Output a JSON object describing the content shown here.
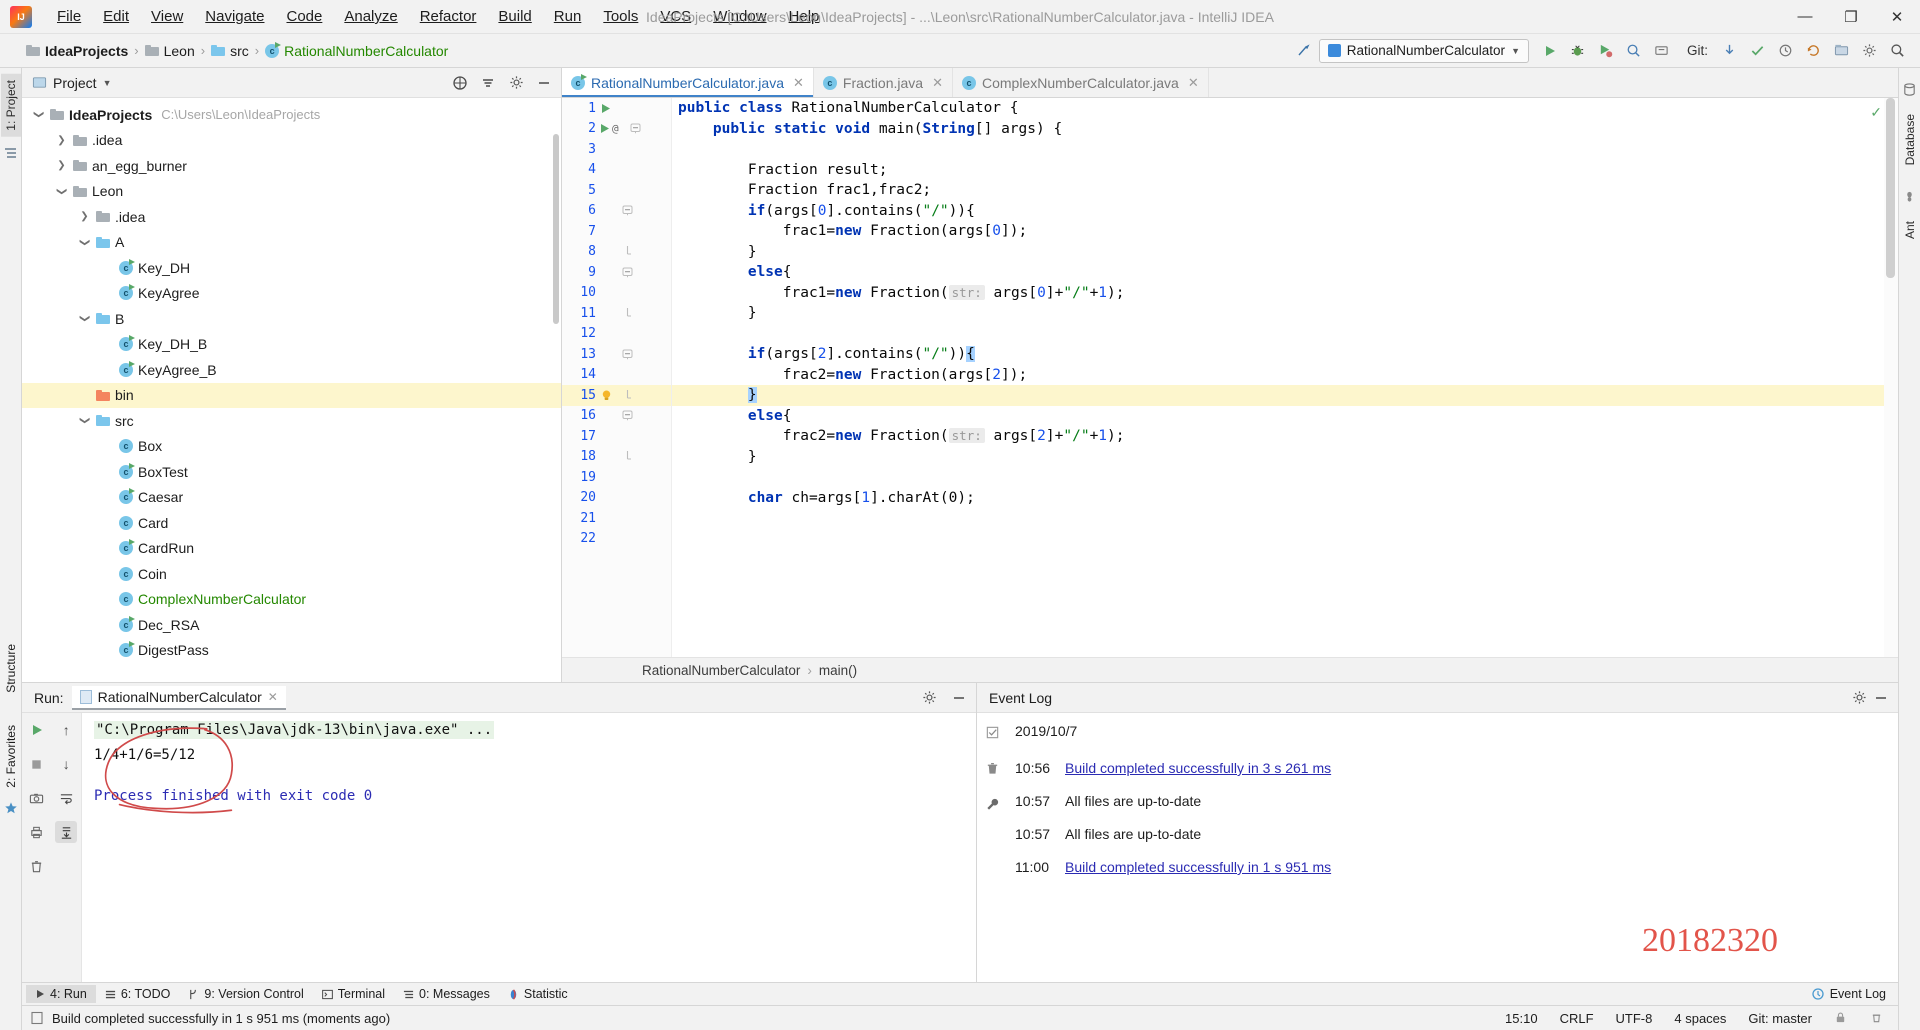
{
  "window": {
    "title": "IdeaProjects [C:\\Users\\Leon\\IdeaProjects] - ...\\Leon\\src\\RationalNumberCalculator.java - IntelliJ IDEA",
    "minimize": "—",
    "maximize": "❐",
    "close": "✕"
  },
  "menu": [
    {
      "label": "File"
    },
    {
      "label": "Edit"
    },
    {
      "label": "View"
    },
    {
      "label": "Navigate"
    },
    {
      "label": "Code"
    },
    {
      "label": "Analyze"
    },
    {
      "label": "Refactor"
    },
    {
      "label": "Build"
    },
    {
      "label": "Run"
    },
    {
      "label": "Tools"
    },
    {
      "label": "VCS"
    },
    {
      "label": "Window"
    },
    {
      "label": "Help"
    }
  ],
  "navbar": {
    "crumbs": [
      {
        "label": "IdeaProjects",
        "icon": "folder-gray",
        "style": "bold"
      },
      {
        "label": "Leon",
        "icon": "folder-gray",
        "style": "normal"
      },
      {
        "label": "src",
        "icon": "folder-blue",
        "style": "normal"
      },
      {
        "label": "RationalNumberCalculator",
        "icon": "class-run",
        "style": "green"
      }
    ],
    "run_config": "RationalNumberCalculator",
    "git_label": "Git:",
    "separator": "›"
  },
  "sidebar_left_tabs": [
    "1: Project",
    "Structure",
    "2: Favorites"
  ],
  "sidebar_right_tabs": [
    "Database",
    "Ant"
  ],
  "project_panel": {
    "title": "Project",
    "tree": [
      {
        "label": "IdeaProjects",
        "sub": "C:\\Users\\Leon\\IdeaProjects",
        "indent": 0,
        "arrow": "down",
        "icon": "folder-gray",
        "bold": true
      },
      {
        "label": ".idea",
        "sub": "",
        "indent": 1,
        "arrow": "right",
        "icon": "folder-gray",
        "bold": false
      },
      {
        "label": "an_egg_burner",
        "sub": "",
        "indent": 1,
        "arrow": "right",
        "icon": "folder-gray",
        "bold": false
      },
      {
        "label": "Leon",
        "sub": "",
        "indent": 1,
        "arrow": "down",
        "icon": "folder-gray",
        "bold": false
      },
      {
        "label": ".idea",
        "sub": "",
        "indent": 2,
        "arrow": "right",
        "icon": "folder-gray",
        "bold": false
      },
      {
        "label": "A",
        "sub": "",
        "indent": 2,
        "arrow": "down",
        "icon": "folder-blue",
        "bold": false
      },
      {
        "label": "Key_DH",
        "sub": "",
        "indent": 3,
        "arrow": "",
        "icon": "class-run",
        "bold": false
      },
      {
        "label": "KeyAgree",
        "sub": "",
        "indent": 3,
        "arrow": "",
        "icon": "class-run",
        "bold": false
      },
      {
        "label": "B",
        "sub": "",
        "indent": 2,
        "arrow": "down",
        "icon": "folder-blue",
        "bold": false
      },
      {
        "label": "Key_DH_B",
        "sub": "",
        "indent": 3,
        "arrow": "",
        "icon": "class-run",
        "bold": false
      },
      {
        "label": "KeyAgree_B",
        "sub": "",
        "indent": 3,
        "arrow": "",
        "icon": "class-run",
        "bold": false
      },
      {
        "label": "bin",
        "sub": "",
        "indent": 2,
        "arrow": "",
        "icon": "folder-orange",
        "bold": false,
        "highlight": true
      },
      {
        "label": "src",
        "sub": "",
        "indent": 2,
        "arrow": "down",
        "icon": "folder-blue",
        "bold": false
      },
      {
        "label": "Box",
        "sub": "",
        "indent": 3,
        "arrow": "",
        "icon": "class",
        "bold": false
      },
      {
        "label": "BoxTest",
        "sub": "",
        "indent": 3,
        "arrow": "",
        "icon": "class-run",
        "bold": false
      },
      {
        "label": "Caesar",
        "sub": "",
        "indent": 3,
        "arrow": "",
        "icon": "class-run",
        "bold": false
      },
      {
        "label": "Card",
        "sub": "",
        "indent": 3,
        "arrow": "",
        "icon": "class",
        "bold": false
      },
      {
        "label": "CardRun",
        "sub": "",
        "indent": 3,
        "arrow": "",
        "icon": "class-run",
        "bold": false
      },
      {
        "label": "Coin",
        "sub": "",
        "indent": 3,
        "arrow": "",
        "icon": "class",
        "bold": false
      },
      {
        "label": "ComplexNumberCalculator",
        "sub": "",
        "indent": 3,
        "arrow": "",
        "icon": "class",
        "bold": false,
        "green": true
      },
      {
        "label": "Dec_RSA",
        "sub": "",
        "indent": 3,
        "arrow": "",
        "icon": "class-run",
        "bold": false
      },
      {
        "label": "DigestPass",
        "sub": "",
        "indent": 3,
        "arrow": "",
        "icon": "class-run",
        "bold": false
      }
    ]
  },
  "editor": {
    "tabs": [
      {
        "label": "RationalNumberCalculator.java",
        "active": true,
        "close": "✕"
      },
      {
        "label": "Fraction.java",
        "active": false,
        "close": "✕"
      },
      {
        "label": "ComplexNumberCalculator.java",
        "active": false,
        "close": "✕"
      }
    ],
    "lines": [
      {
        "n": 1,
        "mark": "run",
        "fold": "",
        "hl": false
      },
      {
        "n": 2,
        "mark": "run@",
        "fold": "minus",
        "hl": false
      },
      {
        "n": 3,
        "mark": "",
        "fold": "",
        "hl": false
      },
      {
        "n": 4,
        "mark": "",
        "fold": "",
        "hl": false
      },
      {
        "n": 5,
        "mark": "",
        "fold": "",
        "hl": false
      },
      {
        "n": 6,
        "mark": "",
        "fold": "minus",
        "hl": false
      },
      {
        "n": 7,
        "mark": "",
        "fold": "",
        "hl": false
      },
      {
        "n": 8,
        "mark": "",
        "fold": "end",
        "hl": false
      },
      {
        "n": 9,
        "mark": "",
        "fold": "minus",
        "hl": false
      },
      {
        "n": 10,
        "mark": "",
        "fold": "",
        "hl": false
      },
      {
        "n": 11,
        "mark": "",
        "fold": "end",
        "hl": false
      },
      {
        "n": 12,
        "mark": "",
        "fold": "",
        "hl": false
      },
      {
        "n": 13,
        "mark": "",
        "fold": "minus",
        "hl": false
      },
      {
        "n": 14,
        "mark": "",
        "fold": "",
        "hl": false
      },
      {
        "n": 15,
        "mark": "bulb",
        "fold": "end",
        "hl": true
      },
      {
        "n": 16,
        "mark": "",
        "fold": "minus",
        "hl": false
      },
      {
        "n": 17,
        "mark": "",
        "fold": "",
        "hl": false
      },
      {
        "n": 18,
        "mark": "",
        "fold": "end",
        "hl": false
      },
      {
        "n": 19,
        "mark": "",
        "fold": "",
        "hl": false
      },
      {
        "n": 20,
        "mark": "",
        "fold": "",
        "hl": false
      },
      {
        "n": 21,
        "mark": "",
        "fold": "",
        "hl": false
      },
      {
        "n": 22,
        "mark": "",
        "fold": "",
        "hl": false
      }
    ],
    "code": [
      "public class RationalNumberCalculator {",
      "    public static void main(String[] args) {",
      "",
      "        Fraction result;",
      "        Fraction frac1,frac2;",
      "        if(args[0].contains(\"/\")){",
      "            frac1=new Fraction(args[0]);",
      "        }",
      "        else{",
      "            frac1=new Fraction( str: args[0]+\"/\"+1);",
      "        }",
      "",
      "        if(args[2].contains(\"/\")){",
      "            frac2=new Fraction(args[2]);",
      "        }",
      "        else{",
      "            frac2=new Fraction( str: args[2]+\"/\"+1);",
      "        }",
      "",
      "        char ch=args[1].charAt(0);",
      "",
      ""
    ],
    "breadcrumb": [
      "RationalNumberCalculator",
      "main()"
    ],
    "breadcrumb_sep": "›"
  },
  "run_panel": {
    "label": "Run:",
    "tab": "RationalNumberCalculator",
    "close": "✕",
    "console": {
      "command": "\"C:\\Program Files\\Java\\jdk-13\\bin\\java.exe\" ...",
      "output": "1/4+1/6=5/12",
      "exit": "Process finished with exit code 0"
    }
  },
  "event_log": {
    "title": "Event Log",
    "date": "2019/10/7",
    "rows": [
      {
        "time": "10:56",
        "message": "Build completed successfully in 3 s 261 ms",
        "link": true
      },
      {
        "time": "10:57",
        "message": "All files are up-to-date",
        "link": false
      },
      {
        "time": "10:57",
        "message": "All files are up-to-date",
        "link": false
      },
      {
        "time": "11:00",
        "message": "Build completed successfully in 1 s 951 ms",
        "link": true
      }
    ],
    "watermark": "20182320"
  },
  "toolwindow_bar": {
    "items": [
      {
        "label": "4: Run",
        "icon": "play-icon",
        "active": true
      },
      {
        "label": "6: TODO",
        "icon": "todo-icon",
        "active": false
      },
      {
        "label": "9: Version Control",
        "icon": "branch-icon",
        "active": false
      },
      {
        "label": "Terminal",
        "icon": "terminal-icon",
        "active": false
      },
      {
        "label": "0: Messages",
        "icon": "messages-icon",
        "active": false
      },
      {
        "label": "Statistic",
        "icon": "statistic-icon",
        "active": false
      }
    ],
    "right_label": "Event Log"
  },
  "statusbar": {
    "message": "Build completed successfully in 1 s 951 ms (moments ago)",
    "time": "15:10",
    "line_sep": "CRLF",
    "encoding": "UTF-8",
    "indent": "4 spaces",
    "git": "Git: master"
  },
  "colors": {
    "accent": "#4083c9",
    "link": "#2b2bb3",
    "keyword": "#0033b3",
    "string": "#067d17",
    "number": "#1750eb",
    "green_run": "#59a869",
    "highlight_row": "#fdf6cd",
    "watermark": "#e2544a"
  }
}
